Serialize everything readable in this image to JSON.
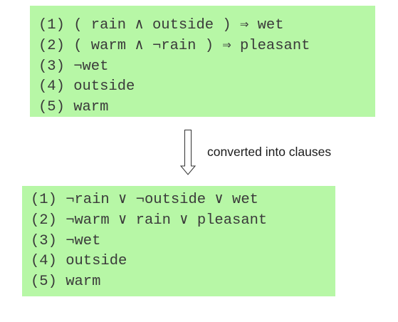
{
  "premises": [
    "(1) ( rain ∧ outside ) ⇒ wet",
    "(2) ( warm ∧ ¬rain ) ⇒ pleasant",
    "(3) ¬wet",
    "(4) outside",
    "(5) warm"
  ],
  "arrow_label": "converted into clauses",
  "clauses": [
    "(1) ¬rain ∨ ¬outside ∨ wet",
    "(2) ¬warm ∨ rain ∨ pleasant",
    "(3) ¬wet",
    "(4) outside",
    "(5) warm"
  ],
  "colors": {
    "box_background": "#b7f7a6",
    "text": "#3a3a3a"
  }
}
